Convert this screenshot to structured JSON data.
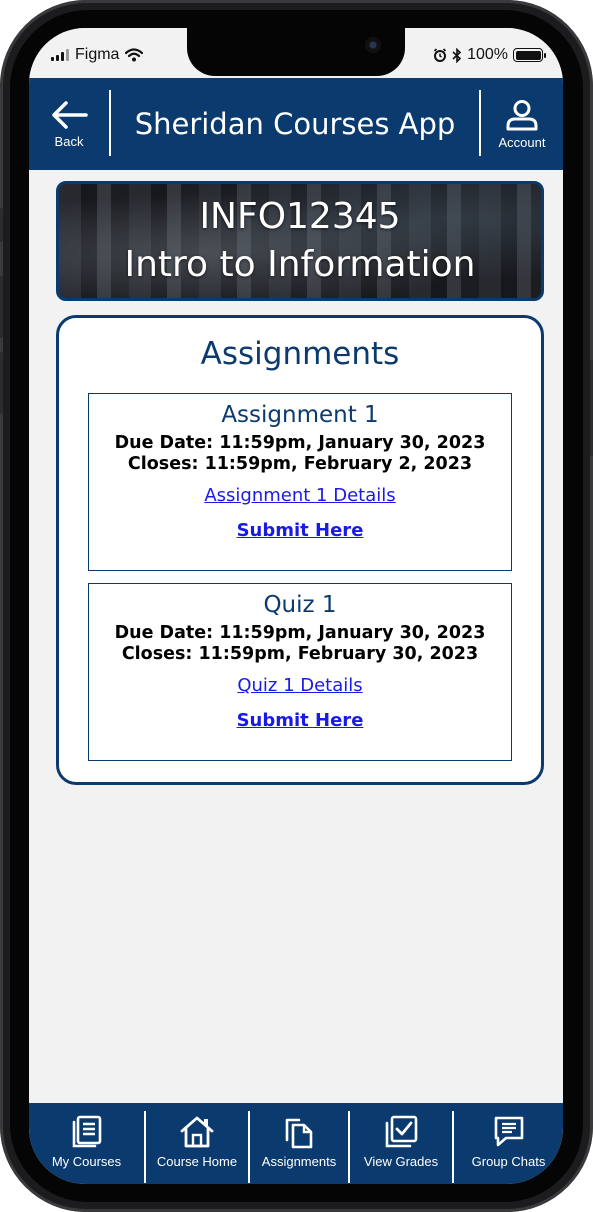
{
  "status_bar": {
    "carrier": "Figma",
    "battery": "100%"
  },
  "header": {
    "back_label": "Back",
    "title": "Sheridan Courses App",
    "account_label": "Account"
  },
  "course": {
    "code": "INFO12345",
    "name": "Intro to Information"
  },
  "assignments": {
    "title": "Assignments",
    "items": [
      {
        "name": "Assignment 1",
        "due": "Due Date: 11:59pm, January 30, 2023",
        "closes": "Closes: 11:59pm, February 2, 2023",
        "details_link": "Assignment 1 Details",
        "submit_label": "Submit Here"
      },
      {
        "name": "Quiz 1",
        "due": "Due Date: 11:59pm, January 30, 2023",
        "closes": "Closes: 11:59pm, February 30, 2023",
        "details_link": "Quiz 1 Details",
        "submit_label": "Submit Here"
      }
    ]
  },
  "bottom_nav": {
    "items": [
      {
        "label": "My Courses",
        "icon": "book-icon"
      },
      {
        "label": "Course Home",
        "icon": "home-icon"
      },
      {
        "label": "Assignments",
        "icon": "documents-icon"
      },
      {
        "label": "View Grades",
        "icon": "checkbox-icon"
      },
      {
        "label": "Group Chats",
        "icon": "chat-icon"
      }
    ]
  },
  "colors": {
    "primary": "#0b3a6e",
    "link": "#1a1ae8",
    "background": "#f2f2f3"
  }
}
